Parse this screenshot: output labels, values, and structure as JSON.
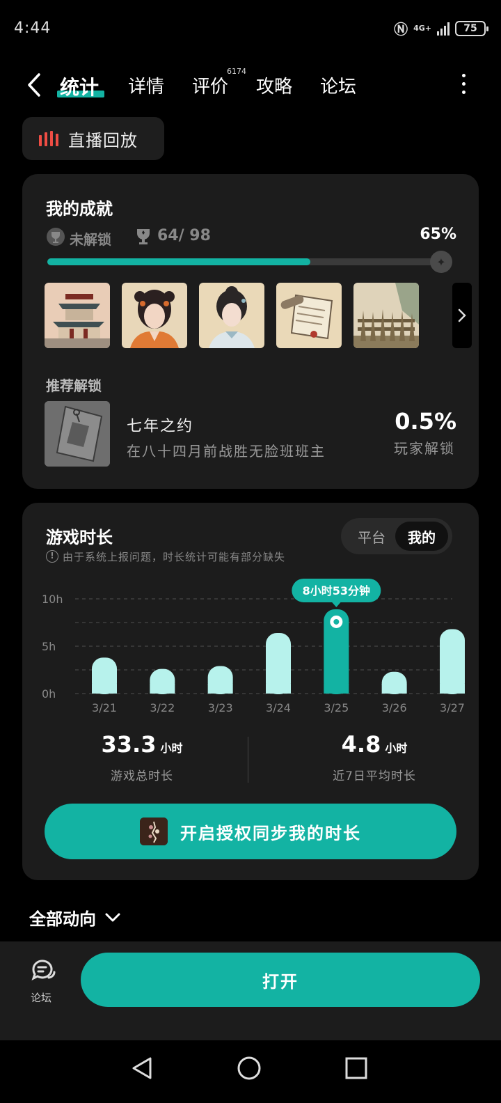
{
  "status": {
    "time": "4:44",
    "network": "4G+",
    "battery": "75"
  },
  "nav": {
    "tabs": [
      {
        "label": "统计",
        "active": true
      },
      {
        "label": "详情"
      },
      {
        "label": "评价",
        "badge": "6174"
      },
      {
        "label": "攻略"
      },
      {
        "label": "论坛"
      }
    ]
  },
  "replay": {
    "label": "直播回放"
  },
  "achievements": {
    "title": "我的成就",
    "locked_label": "未解锁",
    "count": "64/ 98",
    "percent": "65%",
    "progress": 0.65,
    "thumbnails": [
      "pavilion",
      "girl-orange",
      "girl-white",
      "scroll",
      "fence"
    ],
    "recommended_title": "推荐解锁",
    "recommended": {
      "name": "七年之约",
      "desc": "在八十四月前战胜无脸班班主",
      "percent": "0.5%",
      "percent_label": "玩家解锁"
    }
  },
  "playtime": {
    "title": "游戏时长",
    "note": "由于系统上报问题，时长统计可能有部分缺失",
    "segments": [
      "平台",
      "我的"
    ],
    "active_segment": "我的",
    "total_value": "33.3",
    "total_unit": "小时",
    "total_label": "游戏总时长",
    "avg_value": "4.8",
    "avg_unit": "小时",
    "avg_label": "近7日平均时长",
    "sync_label": "开启授权同步我的时长"
  },
  "chart_data": {
    "type": "bar",
    "categories": [
      "3/21",
      "3/22",
      "3/23",
      "3/24",
      "3/25",
      "3/26",
      "3/27"
    ],
    "values": [
      3.8,
      2.6,
      2.9,
      6.4,
      8.9,
      2.3,
      6.8
    ],
    "y_ticks": [
      "10h",
      "5h",
      "0h"
    ],
    "ylim": [
      0,
      10
    ],
    "highlight_index": 4,
    "highlight_label": "8小时53分钟",
    "colors": {
      "bar": "#b7f2ec",
      "highlight": "#13b3a3"
    }
  },
  "all_activity": {
    "label": "全部动向"
  },
  "bottom": {
    "forum_label": "论坛",
    "open_label": "打开"
  },
  "colors": {
    "accent": "#13b3a3",
    "card": "#1c1c1c"
  }
}
